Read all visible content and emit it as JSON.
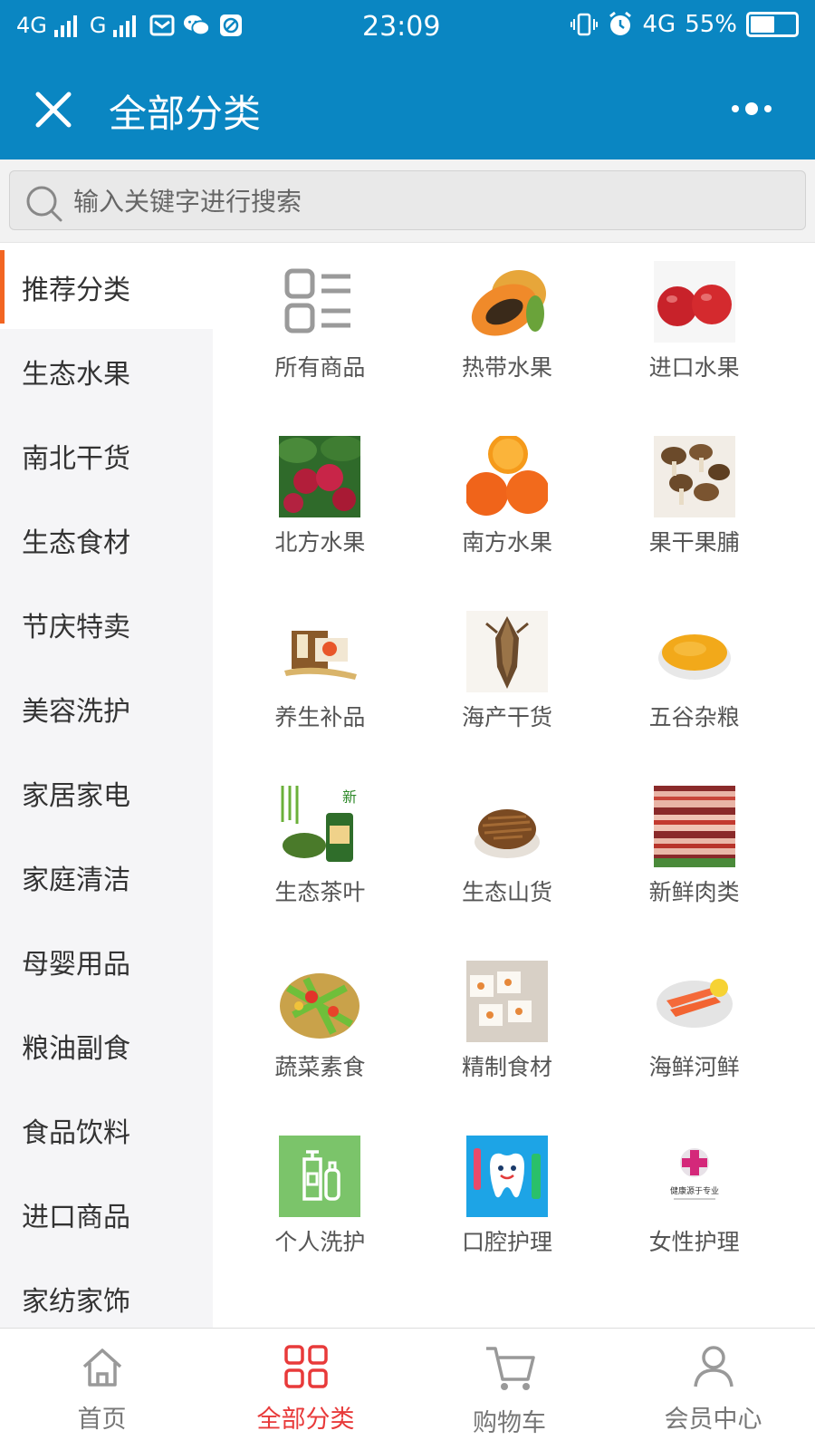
{
  "status_bar": {
    "network1": "4G",
    "network2": "G",
    "time": "23:09",
    "network3": "4G",
    "battery_text": "55%",
    "battery_level": 0.55
  },
  "header": {
    "title": "全部分类"
  },
  "search": {
    "placeholder": "输入关键字进行搜索"
  },
  "sidebar": {
    "items": [
      {
        "label": "推荐分类"
      },
      {
        "label": "生态水果"
      },
      {
        "label": "南北干货"
      },
      {
        "label": "生态食材"
      },
      {
        "label": "节庆特卖"
      },
      {
        "label": "美容洗护"
      },
      {
        "label": "家居家电"
      },
      {
        "label": "家庭清洁"
      },
      {
        "label": "母婴用品"
      },
      {
        "label": "粮油副食"
      },
      {
        "label": "食品饮料"
      },
      {
        "label": "进口商品"
      },
      {
        "label": "家纺家饰"
      }
    ]
  },
  "categories": [
    {
      "label": "所有商品",
      "icon": "all-products-icon"
    },
    {
      "label": "热带水果",
      "icon": "papaya-image"
    },
    {
      "label": "进口水果",
      "icon": "apples-image"
    },
    {
      "label": "北方水果",
      "icon": "apple-tree-image"
    },
    {
      "label": "南方水果",
      "icon": "oranges-image"
    },
    {
      "label": "果干果脯",
      "icon": "mushrooms-image"
    },
    {
      "label": "养生补品",
      "icon": "ginseng-box-image"
    },
    {
      "label": "海产干货",
      "icon": "dried-squid-image"
    },
    {
      "label": "五谷杂粮",
      "icon": "millet-bowl-image"
    },
    {
      "label": "生态茶叶",
      "icon": "green-tea-image"
    },
    {
      "label": "生态山货",
      "icon": "dried-herbs-bowl-image"
    },
    {
      "label": "新鲜肉类",
      "icon": "pork-belly-image"
    },
    {
      "label": "蔬菜素食",
      "icon": "vegetable-salad-image"
    },
    {
      "label": "精制食材",
      "icon": "nougat-candy-image"
    },
    {
      "label": "海鲜河鲜",
      "icon": "salmon-plate-image"
    },
    {
      "label": "个人洗护",
      "icon": "bottles-icon"
    },
    {
      "label": "口腔护理",
      "icon": "tooth-cartoon-image"
    },
    {
      "label": "女性护理",
      "icon": "female-care-logo",
      "logo_text": "健康源于专业"
    }
  ],
  "tabbar": [
    {
      "label": "首页",
      "icon": "home-icon"
    },
    {
      "label": "全部分类",
      "icon": "grid-icon"
    },
    {
      "label": "购物车",
      "icon": "cart-icon"
    },
    {
      "label": "会员中心",
      "icon": "user-icon"
    }
  ],
  "colors": {
    "header_bg": "#0a86c2",
    "accent_active": "#e83a3a",
    "sidebar_indicator": "#f26522"
  }
}
